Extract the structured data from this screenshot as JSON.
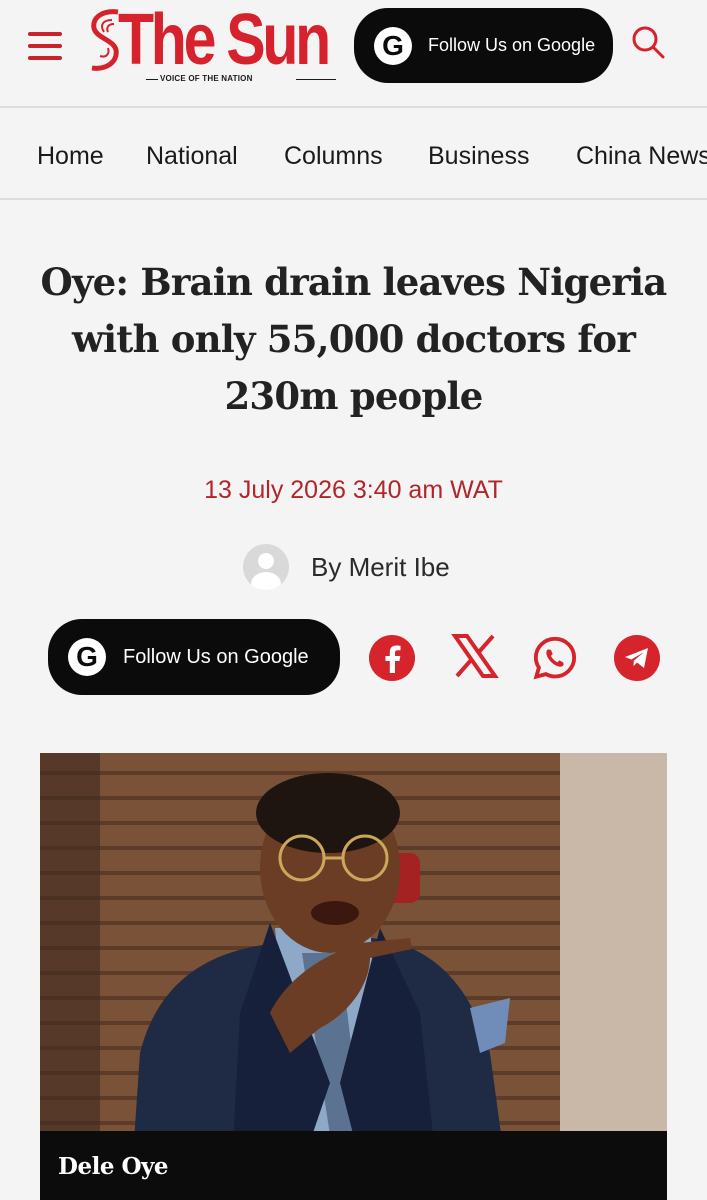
{
  "header": {
    "logo_text": "The Sun",
    "tagline": "VOICE OF THE NATION",
    "follow_label": "Follow Us on Google",
    "google_letter": "G",
    "brand_color": "#d6222c"
  },
  "nav": {
    "items": [
      {
        "label": "Home"
      },
      {
        "label": "National"
      },
      {
        "label": "Columns"
      },
      {
        "label": "Business"
      },
      {
        "label": "China News"
      }
    ]
  },
  "article": {
    "headline": "Oye: Brain drain leaves Nigeria with only 55,000 doctors for 230m people",
    "date": "13 July 2026 3:40 am WAT",
    "byline": "By Merit Ibe",
    "follow_label": "Follow Us on Google",
    "google_letter": "G",
    "share": [
      {
        "icon": "facebook-icon"
      },
      {
        "icon": "x-icon"
      },
      {
        "icon": "whatsapp-icon"
      },
      {
        "icon": "telegram-icon"
      }
    ],
    "photo_caption": "Dele Oye",
    "accent_color": "#b0262b"
  }
}
